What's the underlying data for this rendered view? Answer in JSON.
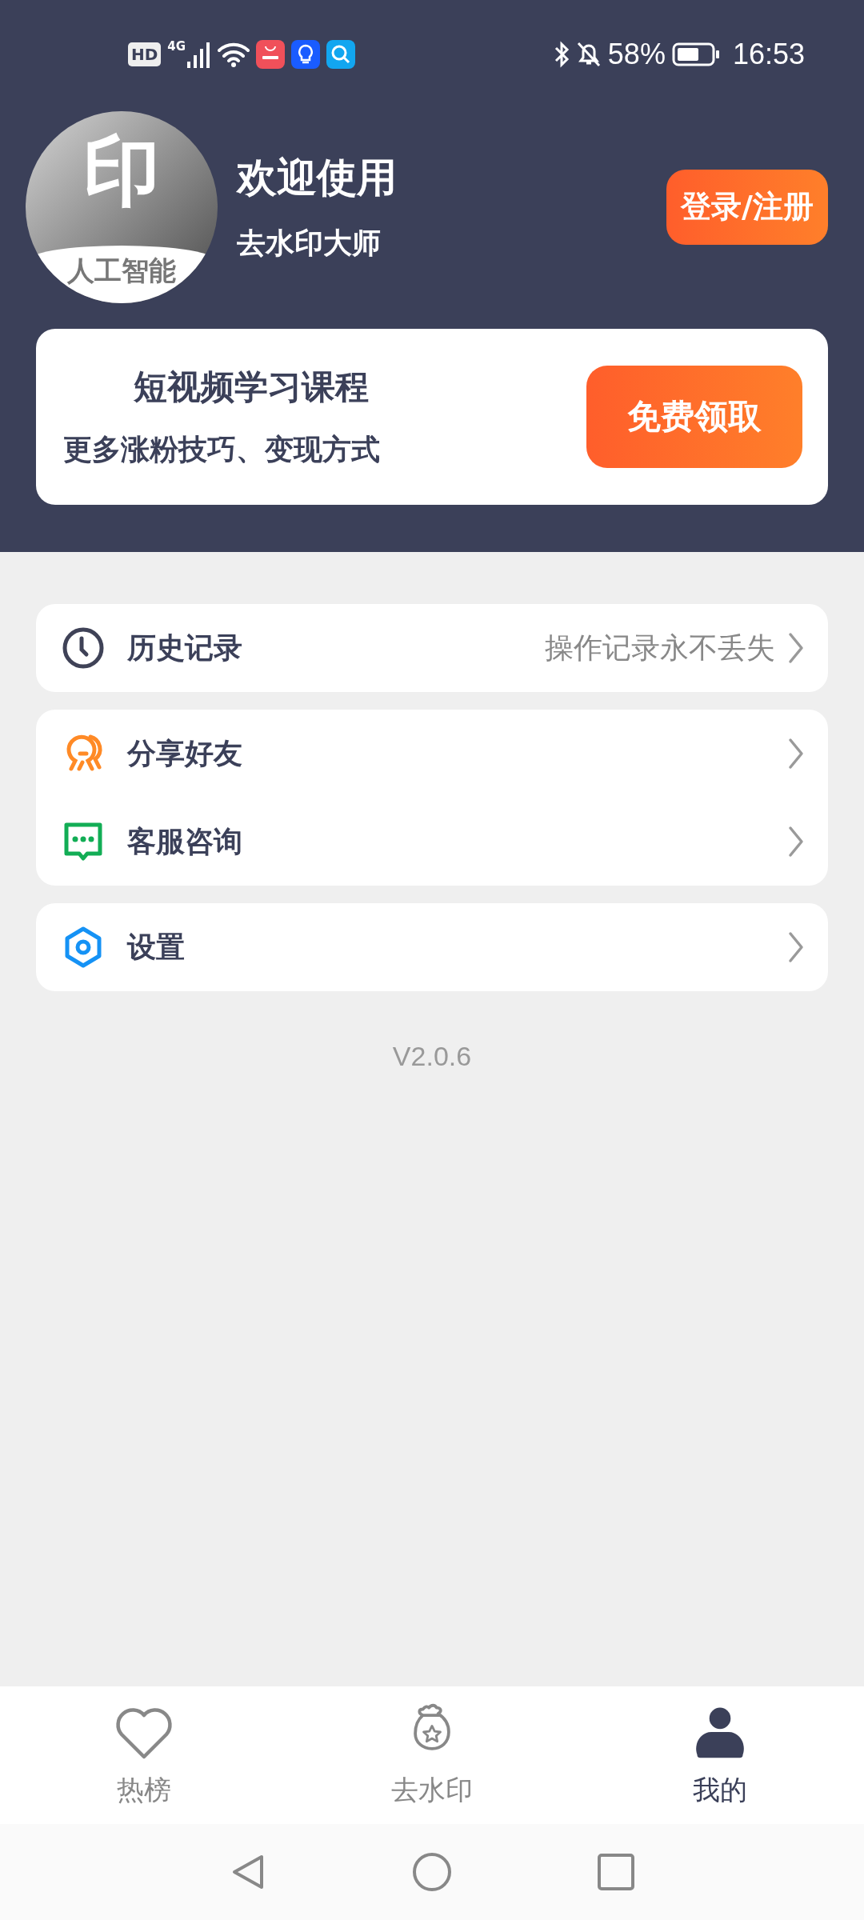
{
  "status_bar": {
    "hd": "HD",
    "network": "4G",
    "battery": "58%",
    "time": "16:53"
  },
  "profile": {
    "avatar_mark": "印",
    "avatar_caption": "人工智能",
    "title": "欢迎使用",
    "subtitle": "去水印大师",
    "login_button": "登录/注册"
  },
  "promo": {
    "title": "短视频学习课程",
    "subtitle": "更多涨粉技巧、变现方式",
    "button": "免费领取"
  },
  "menu_groups": [
    {
      "items": [
        {
          "kind": "history",
          "label": "历史记录",
          "hint": "操作记录永不丢失"
        }
      ]
    },
    {
      "items": [
        {
          "kind": "share",
          "label": "分享好友"
        },
        {
          "kind": "support",
          "label": "客服咨询"
        }
      ]
    },
    {
      "items": [
        {
          "kind": "settings",
          "label": "设置"
        }
      ]
    }
  ],
  "version": "V2.0.6",
  "tabs": [
    {
      "kind": "hot",
      "label": "热榜",
      "selected": false
    },
    {
      "kind": "watermark",
      "label": "去水印",
      "selected": false
    },
    {
      "kind": "mine",
      "label": "我的",
      "selected": true
    }
  ]
}
